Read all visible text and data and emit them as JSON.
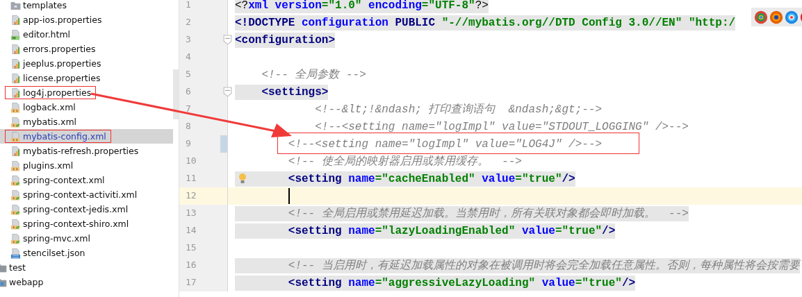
{
  "project_tree": {
    "items": [
      {
        "label": "templates",
        "kind": "folder",
        "selected": false,
        "boxed": false
      },
      {
        "label": "app-ios.properties",
        "kind": "properties",
        "selected": false,
        "boxed": false
      },
      {
        "label": "editor.html",
        "kind": "html",
        "selected": false,
        "boxed": false
      },
      {
        "label": "errors.properties",
        "kind": "properties",
        "selected": false,
        "boxed": false
      },
      {
        "label": "jeeplus.properties",
        "kind": "properties",
        "selected": false,
        "boxed": false
      },
      {
        "label": "license.properties",
        "kind": "properties",
        "selected": false,
        "boxed": false
      },
      {
        "label": "log4j.properties",
        "kind": "properties",
        "selected": false,
        "boxed": true
      },
      {
        "label": "logback.xml",
        "kind": "xml",
        "selected": false,
        "boxed": false
      },
      {
        "label": "mybatis.xml",
        "kind": "spring-xml",
        "selected": false,
        "boxed": false
      },
      {
        "label": "mybatis-config.xml",
        "kind": "xml",
        "selected": true,
        "boxed": true
      },
      {
        "label": "mybatis-refresh.properties",
        "kind": "properties",
        "selected": false,
        "boxed": false
      },
      {
        "label": "plugins.xml",
        "kind": "xml",
        "selected": false,
        "boxed": false
      },
      {
        "label": "spring-context.xml",
        "kind": "spring-xml",
        "selected": false,
        "boxed": false
      },
      {
        "label": "spring-context-activiti.xml",
        "kind": "spring-xml",
        "selected": false,
        "boxed": false
      },
      {
        "label": "spring-context-jedis.xml",
        "kind": "spring-xml",
        "selected": false,
        "boxed": false
      },
      {
        "label": "spring-context-shiro.xml",
        "kind": "spring-xml",
        "selected": false,
        "boxed": false
      },
      {
        "label": "spring-mvc.xml",
        "kind": "spring-xml",
        "selected": false,
        "boxed": false
      },
      {
        "label": "stencilset.json",
        "kind": "json",
        "selected": false,
        "boxed": false
      }
    ],
    "parent_items": [
      {
        "label": "test",
        "kind": "folder",
        "selected": false
      },
      {
        "label": "webapp",
        "kind": "web-folder",
        "selected": false
      }
    ]
  },
  "editor": {
    "lines": [
      {
        "number": "1",
        "shaded": true,
        "fold": false,
        "current": false,
        "marked": false,
        "hint": false,
        "boxed": false,
        "tokens": [
          {
            "kind": "plain",
            "text": "<?"
          },
          {
            "kind": "attr",
            "text": "xml "
          },
          {
            "kind": "attr",
            "text": "version"
          },
          {
            "kind": "str",
            "text": "=\"1.0\" "
          },
          {
            "kind": "attr",
            "text": "encoding"
          },
          {
            "kind": "str",
            "text": "=\"UTF-8\""
          },
          {
            "kind": "plain",
            "text": "?>"
          }
        ]
      },
      {
        "number": "2",
        "shaded": true,
        "fold": false,
        "current": false,
        "marked": false,
        "hint": false,
        "boxed": false,
        "tokens": [
          {
            "kind": "tag",
            "text": "<!DOCTYPE "
          },
          {
            "kind": "attr",
            "text": "configuration "
          },
          {
            "kind": "tag",
            "text": "PUBLIC "
          },
          {
            "kind": "str",
            "text": "\"-//mybatis.org//DTD Config 3.0//EN\" \"http:/"
          }
        ]
      },
      {
        "number": "3",
        "shaded": true,
        "fold": true,
        "current": false,
        "marked": false,
        "hint": false,
        "boxed": false,
        "tokens": [
          {
            "kind": "tag",
            "text": "<configuration>"
          }
        ]
      },
      {
        "number": "4",
        "fold": false,
        "current": false,
        "marked": false,
        "hint": false,
        "boxed": false
      },
      {
        "number": "5",
        "shaded": false,
        "fold": false,
        "current": false,
        "marked": false,
        "hint": false,
        "boxed": false,
        "tokens": [
          {
            "kind": "comment",
            "text": "    <!-- 全局参数 -->"
          }
        ]
      },
      {
        "number": "6",
        "shaded": true,
        "fold": true,
        "current": false,
        "marked": false,
        "hint": false,
        "boxed": false,
        "tokens": [
          {
            "kind": "tag",
            "text": "    <settings>"
          }
        ]
      },
      {
        "number": "7",
        "shaded": false,
        "fold": false,
        "current": false,
        "marked": false,
        "hint": false,
        "boxed": false,
        "tokens": [
          {
            "kind": "comment",
            "text": "            <!--&lt;!&ndash; 打印查询语句  &ndash;&gt;-->"
          }
        ]
      },
      {
        "number": "8",
        "shaded": false,
        "fold": false,
        "current": false,
        "marked": false,
        "hint": false,
        "boxed": false,
        "tokens": [
          {
            "kind": "comment",
            "text": "            <!--<setting name=\"logImpl\" value=\"STDOUT_LOGGING\" />-->"
          }
        ]
      },
      {
        "number": "9",
        "shaded": false,
        "fold": false,
        "current": false,
        "marked": true,
        "hint": false,
        "boxed": true,
        "tokens": [
          {
            "kind": "comment",
            "text": "        <!--<setting name=\"logImpl\" value=\"LOG4J\" />-->"
          }
        ]
      },
      {
        "number": "10",
        "shaded": false,
        "fold": false,
        "current": false,
        "marked": false,
        "hint": false,
        "boxed": false,
        "tokens": [
          {
            "kind": "comment",
            "text": "        <!-- 使全局的映射器启用或禁用缓存。  -->"
          }
        ]
      },
      {
        "number": "11",
        "shaded": true,
        "fold": false,
        "current": false,
        "marked": false,
        "hint": true,
        "boxed": false,
        "tokens": [
          {
            "kind": "tag",
            "text": "        <setting "
          },
          {
            "kind": "attr",
            "text": "name"
          },
          {
            "kind": "str",
            "text": "=\"cacheEnabled\" "
          },
          {
            "kind": "attr",
            "text": "value"
          },
          {
            "kind": "str",
            "text": "=\"true\""
          },
          {
            "kind": "tag",
            "text": "/>"
          }
        ]
      },
      {
        "number": "12",
        "fold": false,
        "current": true,
        "marked": false,
        "hint": false,
        "boxed": false
      },
      {
        "number": "13",
        "shaded": true,
        "fold": false,
        "current": false,
        "marked": false,
        "hint": false,
        "boxed": false,
        "tokens": [
          {
            "kind": "comment",
            "text": "        <!-- 全局启用或禁用延迟加载。当禁用时，所有关联对象都会即时加载。  -->"
          }
        ]
      },
      {
        "number": "14",
        "shaded": true,
        "fold": false,
        "current": false,
        "marked": false,
        "hint": false,
        "boxed": false,
        "tokens": [
          {
            "kind": "tag",
            "text": "        <setting "
          },
          {
            "kind": "attr",
            "text": "name"
          },
          {
            "kind": "str",
            "text": "=\"lazyLoadingEnabled\" "
          },
          {
            "kind": "attr",
            "text": "value"
          },
          {
            "kind": "str",
            "text": "=\"true\""
          },
          {
            "kind": "tag",
            "text": "/>"
          }
        ]
      },
      {
        "number": "15",
        "fold": false,
        "current": false,
        "marked": false,
        "hint": false,
        "boxed": false
      },
      {
        "number": "16",
        "shaded": true,
        "fold": false,
        "current": false,
        "marked": false,
        "hint": false,
        "boxed": false,
        "tokens": [
          {
            "kind": "comment",
            "text": "        <!-- 当启用时，有延迟加载属性的对象在被调用时将会完全加载任意属性。否则，每种属性将会按需要"
          }
        ]
      },
      {
        "number": "17",
        "shaded": true,
        "fold": false,
        "current": false,
        "marked": false,
        "hint": false,
        "boxed": false,
        "tokens": [
          {
            "kind": "tag",
            "text": "        <setting "
          },
          {
            "kind": "attr",
            "text": "name"
          },
          {
            "kind": "str",
            "text": "=\"aggressiveLazyLoading\" "
          },
          {
            "kind": "attr",
            "text": "value"
          },
          {
            "kind": "str",
            "text": "=\"true\""
          },
          {
            "kind": "tag",
            "text": "/>"
          }
        ]
      }
    ]
  },
  "callout_arrow": true
}
